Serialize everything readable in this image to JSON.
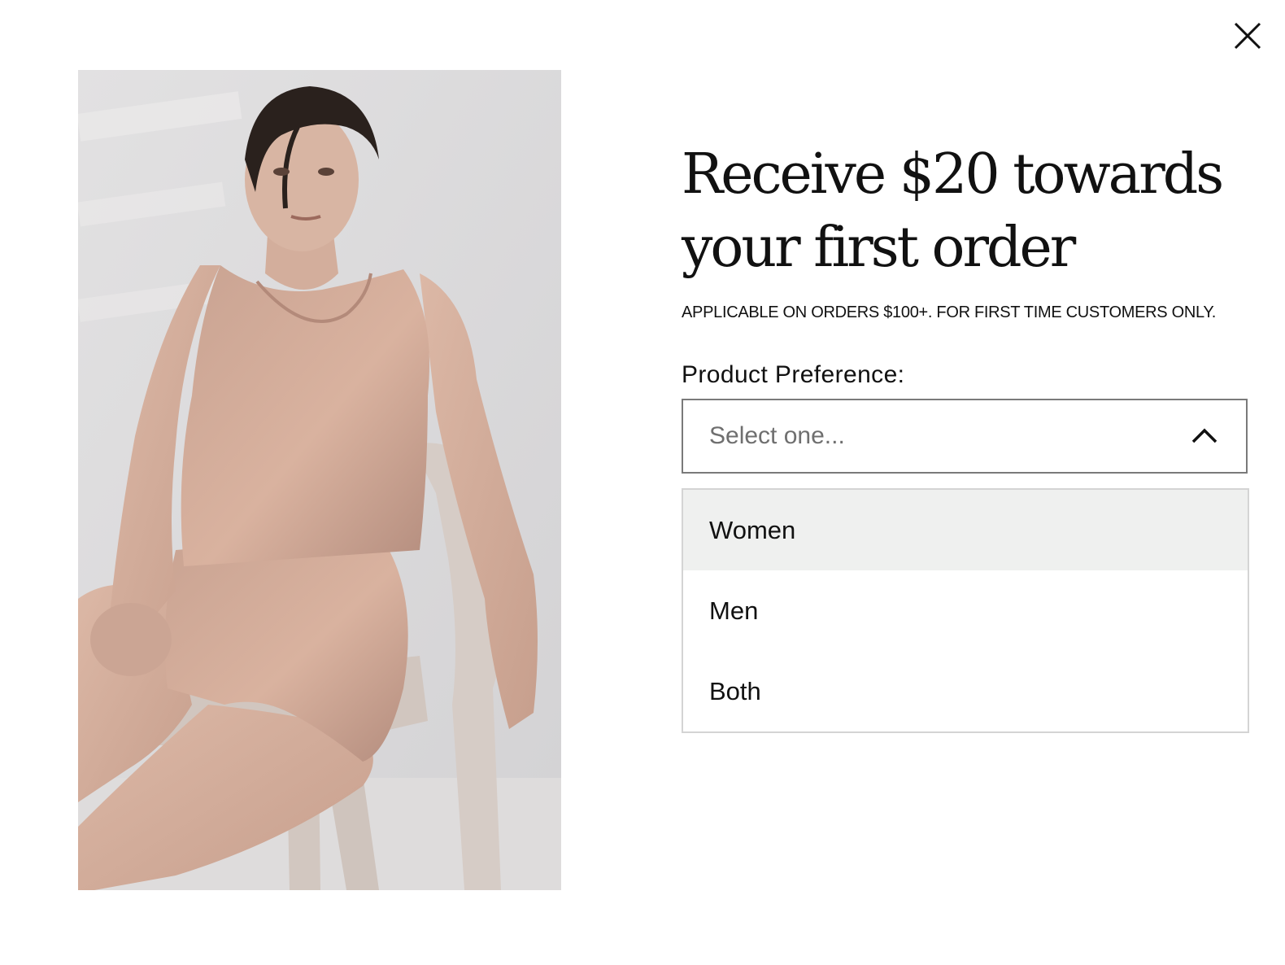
{
  "modal": {
    "close_icon": "close-icon"
  },
  "hero_image": {
    "icon": "model-photo"
  },
  "promo": {
    "headline_line1": "Receive $20 towards",
    "headline_line2": "your first order",
    "disclaimer": "APPLICABLE ON ORDERS $100+. FOR FIRST TIME CUSTOMERS ONLY."
  },
  "form": {
    "preference_label": "Product Preference:",
    "select_placeholder": "Select one...",
    "select_icon": "chevron-up-icon",
    "options": [
      {
        "label": "Women",
        "highlighted": true
      },
      {
        "label": "Men",
        "highlighted": false
      },
      {
        "label": "Both",
        "highlighted": false
      }
    ]
  },
  "colors": {
    "background": "#ffffff",
    "text": "#111111",
    "placeholder": "#6f6f6f",
    "select_border": "#7a7a7a",
    "dropdown_border": "#d4d4d4",
    "option_highlight": "#eff0ef",
    "garment": "#c39b8c"
  }
}
